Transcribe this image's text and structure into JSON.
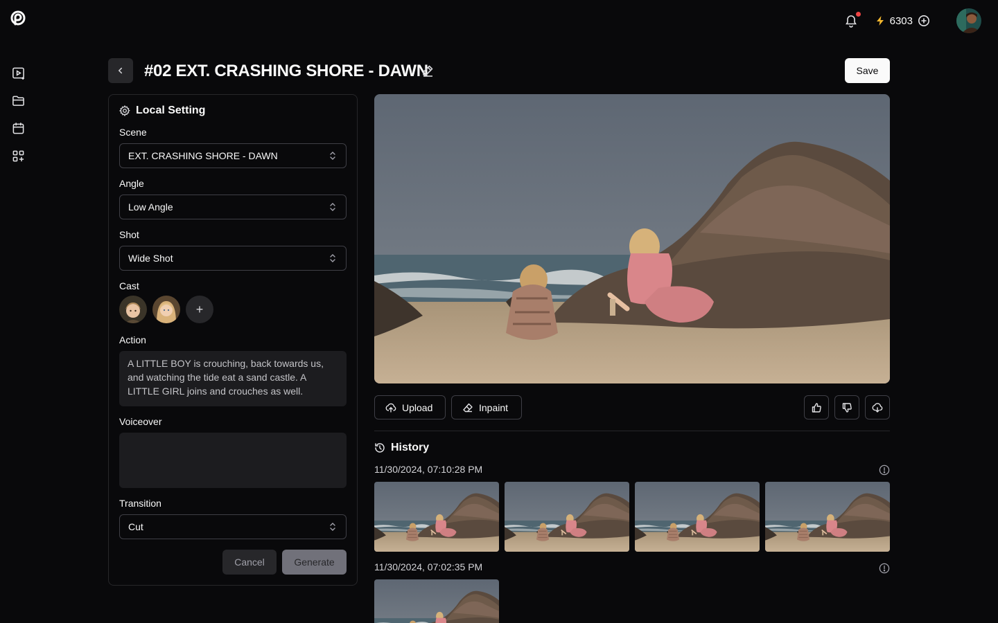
{
  "app": {
    "logo_icon": "brand-logo-icon"
  },
  "sidebar": {
    "items": [
      {
        "icon": "video-play-icon"
      },
      {
        "icon": "folder-icon"
      },
      {
        "icon": "calendar-icon"
      },
      {
        "icon": "apps-add-icon"
      }
    ]
  },
  "topbar": {
    "credits": "6303",
    "notification_dot_color": "#ef4444",
    "bolt_color": "#f5b82e"
  },
  "header": {
    "title": "#02 EXT. CRASHING SHORE - DAWN",
    "save_label": "Save"
  },
  "settings": {
    "heading": "Local Setting",
    "scene_label": "Scene",
    "scene_value": "EXT. CRASHING SHORE - DAWN",
    "angle_label": "Angle",
    "angle_value": "Low Angle",
    "shot_label": "Shot",
    "shot_value": "Wide Shot",
    "cast_label": "Cast",
    "cast_add": "+",
    "action_label": "Action",
    "action_value": "A LITTLE BOY is crouching, back towards us, and watching the tide eat a sand castle. A LITTLE GIRL joins and crouches as well.",
    "voiceover_label": "Voiceover",
    "voiceover_value": "",
    "transition_label": "Transition",
    "transition_value": "Cut",
    "cancel_label": "Cancel",
    "generate_label": "Generate"
  },
  "preview": {
    "upload_label": "Upload",
    "inpaint_label": "Inpaint"
  },
  "history": {
    "heading": "History",
    "groups": [
      {
        "timestamp": "11/30/2024, 07:10:28 PM",
        "count": 4
      },
      {
        "timestamp": "11/30/2024, 07:02:35 PM",
        "count": 1
      }
    ]
  }
}
